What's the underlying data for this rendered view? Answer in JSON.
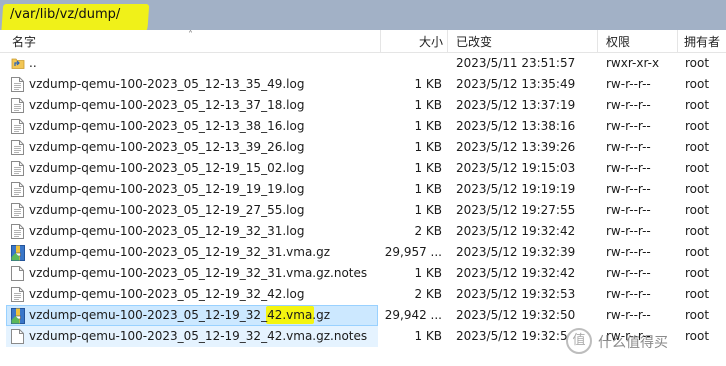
{
  "path": "/var/lib/vz/dump/",
  "columns": {
    "name": "名字",
    "size": "大小",
    "modified": "已改变",
    "perms": "权限",
    "owner": "拥有者"
  },
  "files": [
    {
      "name": "..",
      "size": "",
      "modified": "2023/5/11 23:51:57",
      "perms": "rwxr-xr-x",
      "owner": "root",
      "icon": "parent-folder-icon"
    },
    {
      "name": "vzdump-qemu-100-2023_05_12-13_35_49.log",
      "size": "1 KB",
      "modified": "2023/5/12 13:35:49",
      "perms": "rw-r--r--",
      "owner": "root",
      "icon": "text-file-icon"
    },
    {
      "name": "vzdump-qemu-100-2023_05_12-13_37_18.log",
      "size": "1 KB",
      "modified": "2023/5/12 13:37:19",
      "perms": "rw-r--r--",
      "owner": "root",
      "icon": "text-file-icon"
    },
    {
      "name": "vzdump-qemu-100-2023_05_12-13_38_16.log",
      "size": "1 KB",
      "modified": "2023/5/12 13:38:16",
      "perms": "rw-r--r--",
      "owner": "root",
      "icon": "text-file-icon"
    },
    {
      "name": "vzdump-qemu-100-2023_05_12-13_39_26.log",
      "size": "1 KB",
      "modified": "2023/5/12 13:39:26",
      "perms": "rw-r--r--",
      "owner": "root",
      "icon": "text-file-icon"
    },
    {
      "name": "vzdump-qemu-100-2023_05_12-19_15_02.log",
      "size": "1 KB",
      "modified": "2023/5/12 19:15:03",
      "perms": "rw-r--r--",
      "owner": "root",
      "icon": "text-file-icon"
    },
    {
      "name": "vzdump-qemu-100-2023_05_12-19_19_19.log",
      "size": "1 KB",
      "modified": "2023/5/12 19:19:19",
      "perms": "rw-r--r--",
      "owner": "root",
      "icon": "text-file-icon"
    },
    {
      "name": "vzdump-qemu-100-2023_05_12-19_27_55.log",
      "size": "1 KB",
      "modified": "2023/5/12 19:27:55",
      "perms": "rw-r--r--",
      "owner": "root",
      "icon": "text-file-icon"
    },
    {
      "name": "vzdump-qemu-100-2023_05_12-19_32_31.log",
      "size": "2 KB",
      "modified": "2023/5/12 19:32:42",
      "perms": "rw-r--r--",
      "owner": "root",
      "icon": "text-file-icon"
    },
    {
      "name": "vzdump-qemu-100-2023_05_12-19_32_31.vma.gz",
      "size": "29,957 ...",
      "modified": "2023/5/12 19:32:39",
      "perms": "rw-r--r--",
      "owner": "root",
      "icon": "archive-file-icon"
    },
    {
      "name": "vzdump-qemu-100-2023_05_12-19_32_31.vma.gz.notes",
      "size": "1 KB",
      "modified": "2023/5/12 19:32:42",
      "perms": "rw-r--r--",
      "owner": "root",
      "icon": "blank-file-icon"
    },
    {
      "name": "vzdump-qemu-100-2023_05_12-19_32_42.log",
      "size": "2 KB",
      "modified": "2023/5/12 19:32:53",
      "perms": "rw-r--r--",
      "owner": "root",
      "icon": "text-file-icon"
    },
    {
      "name": "vzdump-qemu-100-2023_05_12-19_32_42.vma.gz",
      "size": "29,942 ...",
      "modified": "2023/5/12 19:32:50",
      "perms": "rw-r--r--",
      "owner": "root",
      "icon": "archive-file-icon"
    },
    {
      "name": "vzdump-qemu-100-2023_05_12-19_32_42.vma.gz.notes",
      "size": "1 KB",
      "modified": "2023/5/12 19:32:5",
      "perms": "rw-r--r--",
      "owner": "root",
      "icon": "blank-file-icon"
    }
  ],
  "selected_index": 12,
  "watermark": "什么值得买",
  "colors": {
    "pathbar": "#a2b1c6",
    "highlight": "#f4f410",
    "selection": "#cce8ff"
  }
}
